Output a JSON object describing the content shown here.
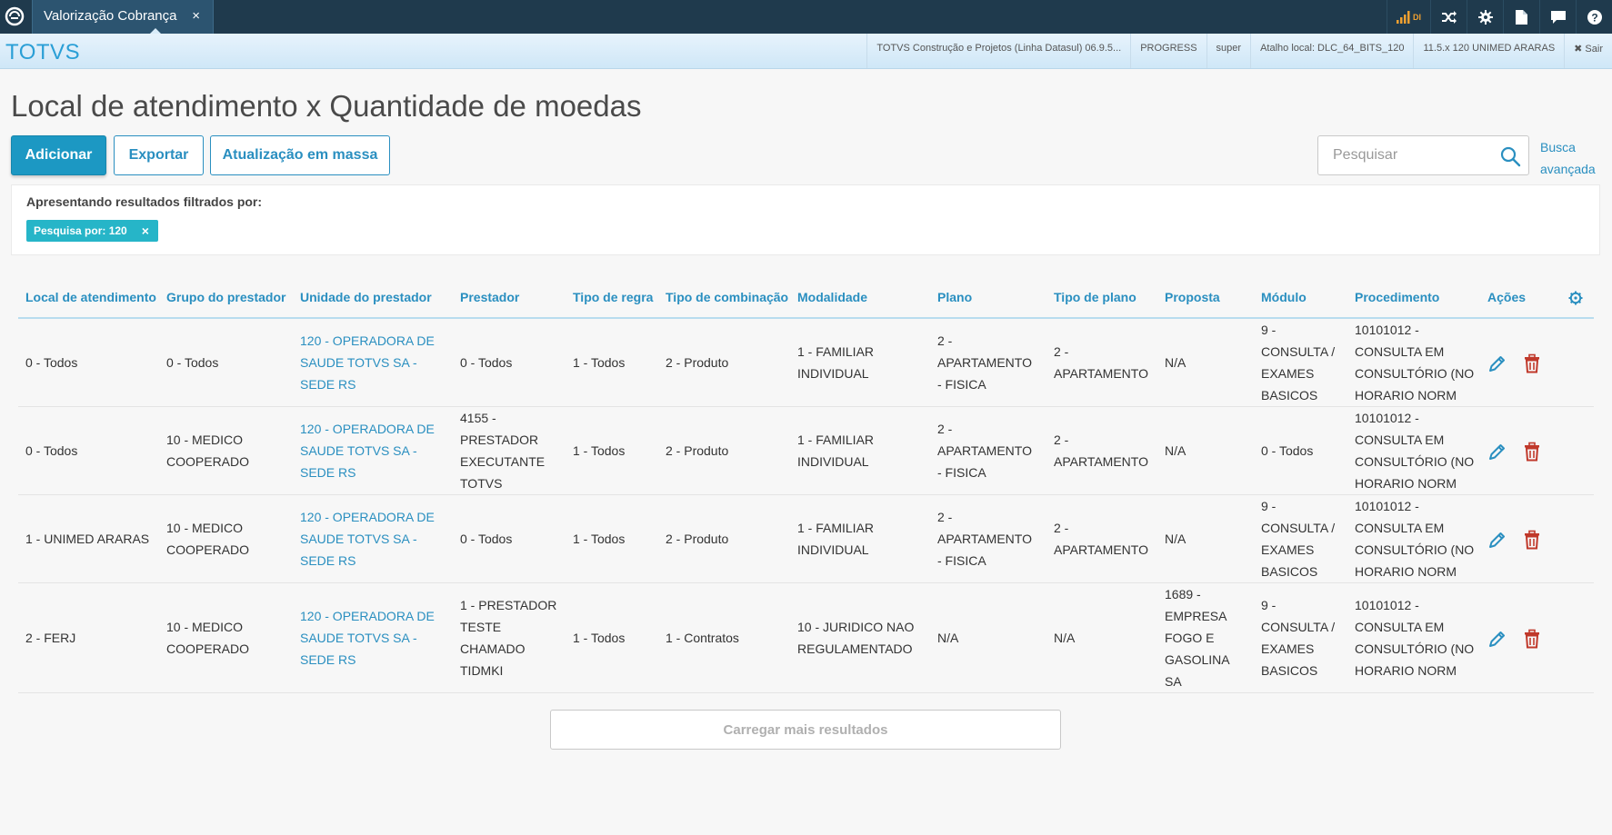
{
  "tab": {
    "label": "Valorização Cobrança",
    "close": "×"
  },
  "topbar": {
    "signal_text": "DI"
  },
  "header": {
    "brand": "TOTVS",
    "product": "TOTVS Construção e Projetos (Linha Datasul) 06.9.5...",
    "database": "PROGRESS",
    "user": "super",
    "shortcut": "Atalho local: DLC_64_BITS_120",
    "company": "11.5.x 120 UNIMED ARARAS",
    "logout": "✖ Sair"
  },
  "page": {
    "title": "Local de atendimento x Quantidade de moedas"
  },
  "toolbar": {
    "add_label": "Adicionar",
    "export_label": "Exportar",
    "mass_update_label": "Atualização em massa"
  },
  "search": {
    "placeholder": "Pesquisar",
    "value": "",
    "advanced_line1": "Busca",
    "advanced_line2": "avançada"
  },
  "filter": {
    "title": "Apresentando resultados filtrados por:",
    "chip_label": "Pesquisa por: 120",
    "chip_close": "×"
  },
  "table": {
    "columns": [
      "Local de atendimento",
      "Grupo do prestador",
      "Unidade do prestador",
      "Prestador",
      "Tipo de regra",
      "Tipo de combinação",
      "Modalidade",
      "Plano",
      "Tipo de plano",
      "Proposta",
      "Módulo",
      "Procedimento",
      "Ações"
    ],
    "rows": [
      {
        "local": [
          "0 - Todos"
        ],
        "grupo": [
          "0 - Todos"
        ],
        "unidade": [
          "120 - OPERADORA DE",
          "SAUDE TOTVS SA -",
          "SEDE RS"
        ],
        "prestador": [
          "0 - Todos"
        ],
        "regra": [
          "1 - Todos"
        ],
        "combinacao": [
          "2 - Produto"
        ],
        "modalidade": [
          "1 - FAMILIAR",
          "INDIVIDUAL"
        ],
        "plano": [
          "2 -",
          "APARTAMENTO",
          "- FISICA"
        ],
        "tipo_plano": [
          "2 -",
          "APARTAMENTO"
        ],
        "proposta": [
          "N/A"
        ],
        "modulo": [
          "9 -",
          "CONSULTA /",
          "EXAMES",
          "BASICOS"
        ],
        "procedimento": [
          "10101012 -",
          "CONSULTA EM",
          "CONSULTÓRIO (NO",
          "HORARIO NORM"
        ]
      },
      {
        "local": [
          "0 - Todos"
        ],
        "grupo": [
          "10 - MEDICO",
          "COOPERADO"
        ],
        "unidade": [
          "120 - OPERADORA DE",
          "SAUDE TOTVS SA -",
          "SEDE RS"
        ],
        "prestador": [
          "4155 -",
          "PRESTADOR",
          "EXECUTANTE",
          "TOTVS"
        ],
        "regra": [
          "1 - Todos"
        ],
        "combinacao": [
          "2 - Produto"
        ],
        "modalidade": [
          "1 - FAMILIAR",
          "INDIVIDUAL"
        ],
        "plano": [
          "2 -",
          "APARTAMENTO",
          "- FISICA"
        ],
        "tipo_plano": [
          "2 -",
          "APARTAMENTO"
        ],
        "proposta": [
          "N/A"
        ],
        "modulo": [
          "0 - Todos"
        ],
        "procedimento": [
          "10101012 -",
          "CONSULTA EM",
          "CONSULTÓRIO (NO",
          "HORARIO NORM"
        ]
      },
      {
        "local": [
          "1 - UNIMED ARARAS"
        ],
        "grupo": [
          "10 - MEDICO",
          "COOPERADO"
        ],
        "unidade": [
          "120 - OPERADORA DE",
          "SAUDE TOTVS SA -",
          "SEDE RS"
        ],
        "prestador": [
          "0 - Todos"
        ],
        "regra": [
          "1 - Todos"
        ],
        "combinacao": [
          "2 - Produto"
        ],
        "modalidade": [
          "1 - FAMILIAR",
          "INDIVIDUAL"
        ],
        "plano": [
          "2 -",
          "APARTAMENTO",
          "- FISICA"
        ],
        "tipo_plano": [
          "2 -",
          "APARTAMENTO"
        ],
        "proposta": [
          "N/A"
        ],
        "modulo": [
          "9 -",
          "CONSULTA /",
          "EXAMES",
          "BASICOS"
        ],
        "procedimento": [
          "10101012 -",
          "CONSULTA EM",
          "CONSULTÓRIO (NO",
          "HORARIO NORM"
        ]
      },
      {
        "local": [
          "2 - FERJ"
        ],
        "grupo": [
          "10 - MEDICO",
          "COOPERADO"
        ],
        "unidade": [
          "120 - OPERADORA DE",
          "SAUDE TOTVS SA -",
          "SEDE RS"
        ],
        "prestador": [
          "1 - PRESTADOR",
          "TESTE",
          "CHAMADO",
          "TIDMKI"
        ],
        "regra": [
          "1 - Todos"
        ],
        "combinacao": [
          "1 - Contratos"
        ],
        "modalidade": [
          "10 - JURIDICO NAO",
          "REGULAMENTADO"
        ],
        "plano": [
          "N/A"
        ],
        "tipo_plano": [
          "N/A"
        ],
        "proposta": [
          "1689 -",
          "EMPRESA",
          "FOGO E",
          "GASOLINA",
          "SA"
        ],
        "modulo": [
          "9 -",
          "CONSULTA /",
          "EXAMES",
          "BASICOS"
        ],
        "procedimento": [
          "10101012 -",
          "CONSULTA EM",
          "CONSULTÓRIO (NO",
          "HORARIO NORM"
        ]
      }
    ]
  },
  "load_more_label": "Carregar mais resultados",
  "icons": {
    "accent": "#2a8fc0",
    "delete_color": "#c0392b",
    "edit": "pencil-icon",
    "delete": "trash-icon",
    "settings": "gear-icon",
    "search": "search-icon"
  }
}
